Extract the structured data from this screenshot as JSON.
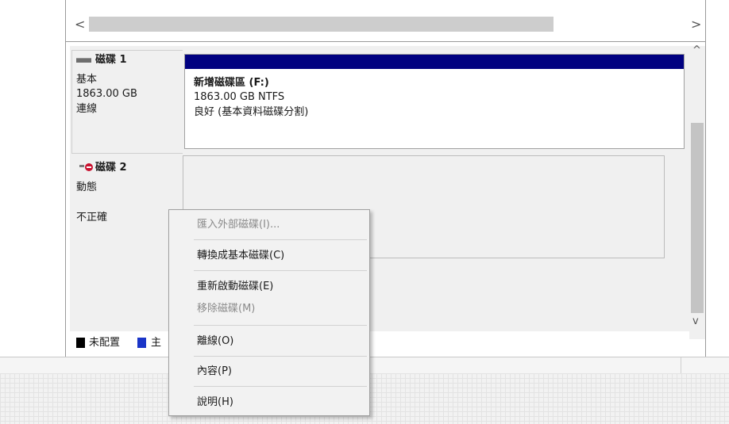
{
  "hscroll": {
    "left_arrow": "<",
    "right_arrow": ">"
  },
  "vscroll": {
    "up_arrow": "^",
    "down_arrow": "v"
  },
  "disk1": {
    "name": "磁碟 1",
    "type": "基本",
    "size": "1863.00 GB",
    "status": "連線",
    "volume": {
      "name": "新增磁碟區  (F:)",
      "size_fs": "1863.00 GB NTFS",
      "health": "良好 (基本資料磁碟分割)"
    }
  },
  "disk2": {
    "name": "磁碟 2",
    "type": "動態",
    "status": "不正確"
  },
  "legend": {
    "unallocated": "未配置",
    "primary": "主"
  },
  "context_menu": {
    "items": [
      {
        "label": "匯入外部磁碟(I)...",
        "enabled": false
      },
      {
        "label": "轉換成基本磁碟(C)",
        "enabled": true
      },
      {
        "label": "重新啟動磁碟(E)",
        "enabled": true
      },
      {
        "label": "移除磁碟(M)",
        "enabled": false
      },
      {
        "label": "離線(O)",
        "enabled": true
      },
      {
        "label": "內容(P)",
        "enabled": true
      },
      {
        "label": "說明(H)",
        "enabled": true
      }
    ]
  },
  "colors": {
    "volume_header": "#000080",
    "unallocated": "#000000",
    "primary": "#1a35c8",
    "error_icon": "#c8102e"
  }
}
